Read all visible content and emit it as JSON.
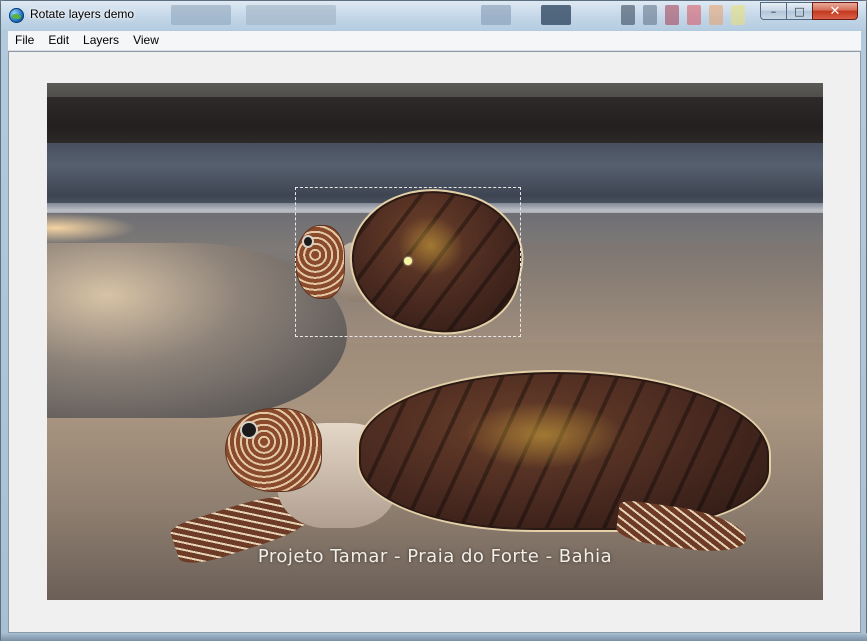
{
  "window": {
    "title": "Rotate layers demo",
    "icon": "globe-icon",
    "buttons": {
      "minimize": "–",
      "maximize": "□",
      "close": "✕"
    }
  },
  "menu": {
    "items": [
      "File",
      "Edit",
      "Layers",
      "View"
    ]
  },
  "canvas": {
    "image_caption": "Projeto Tamar - Praia do Forte - Bahia"
  },
  "colors": {
    "client_bg": "#f0f0f0",
    "selection": "#e8e8e8",
    "pivot": "#f6f3a0"
  }
}
